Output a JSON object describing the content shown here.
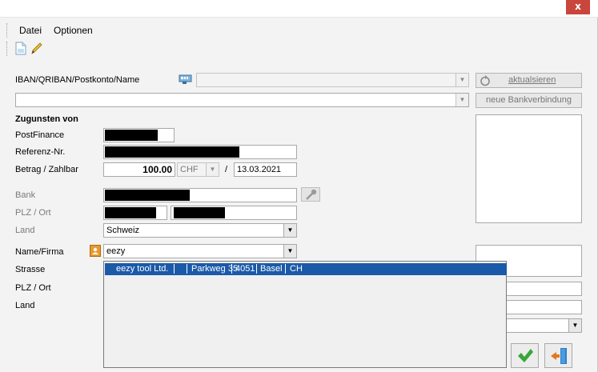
{
  "window": {
    "close_label": "x"
  },
  "menu": {
    "items": [
      "Datei",
      "Optionen"
    ]
  },
  "toolbar": {
    "icons": [
      "new-document-icon",
      "edit-pencil-icon"
    ]
  },
  "form": {
    "iban_label": "IBAN/QRIBAN/Postkonto/Name",
    "update_button": "aktualsieren",
    "new_bank_button": "neue Bankverbindung",
    "section_title": "Zugunsten von",
    "postfinance_label": "PostFinance",
    "reference_label": "Referenz-Nr.",
    "amount_label": "Betrag / Zahlbar",
    "amount_value": "100.00",
    "currency_value": "CHF",
    "date_separator": "/",
    "date_value": "13.03.2021",
    "bank_label": "Bank",
    "bank_zip_city_label": "PLZ / Ort",
    "bank_country_label": "Land",
    "bank_country_value": "Schweiz",
    "name_label": "Name/Firma",
    "name_value": "eezy",
    "street_label": "Strasse",
    "zip_city_label": "PLZ / Ort",
    "country_label": "Land"
  },
  "dropdown": {
    "row": {
      "company": "eezy tool Ltd.",
      "street": "Parkweg 35",
      "zip": "4051",
      "city": "Basel",
      "country": "CH"
    }
  },
  "colors": {
    "selection": "#1a5aa8",
    "close": "#c8463b",
    "ok_green": "#3aa63a"
  }
}
